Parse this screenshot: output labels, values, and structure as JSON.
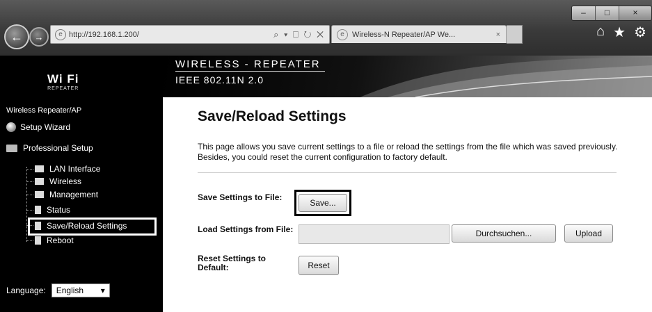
{
  "browser": {
    "address_url": "http://192.168.1.200/",
    "address_tools": "⌕ ▾ ⎕ ↻ ✕",
    "tab_title": "Wireless-N Repeater/AP We...",
    "tab_close": "×",
    "window_buttons": {
      "minimize": "–",
      "maximize": "□",
      "close": "×"
    },
    "right_icons": {
      "home": "⌂",
      "favorites": "★",
      "tools": "⚙"
    }
  },
  "banner": {
    "line1": "WIRELESS - REPEATER",
    "line2": "IEEE 802.11N 2.0"
  },
  "logo": {
    "main": "Wi Fi",
    "sub": "REPEATER"
  },
  "sidebar": {
    "title": "Wireless Repeater/AP",
    "setup_wizard": "Setup Wizard",
    "professional_setup": "Professional Setup",
    "items": [
      "LAN Interface",
      "Wireless",
      "Management",
      "Status",
      "Save/Reload Settings",
      "Reboot"
    ]
  },
  "language": {
    "label": "Language:",
    "value": "English"
  },
  "content": {
    "title": "Save/Reload Settings",
    "description": "This page allows you save current settings to a file or reload the settings from the file which was saved previously. Besides, you could reset the current configuration to factory default.",
    "save_label": "Save Settings to File:",
    "save_button": "Save...",
    "load_label": "Load Settings from File:",
    "browse_button": "Durchsuchen...",
    "upload_button": "Upload",
    "reset_label": "Reset Settings to Default:",
    "reset_button": "Reset"
  },
  "colors": {
    "sidebar_bg": "#000000",
    "page_bg": "#ffffff",
    "chrome": "#3a3a3a"
  }
}
